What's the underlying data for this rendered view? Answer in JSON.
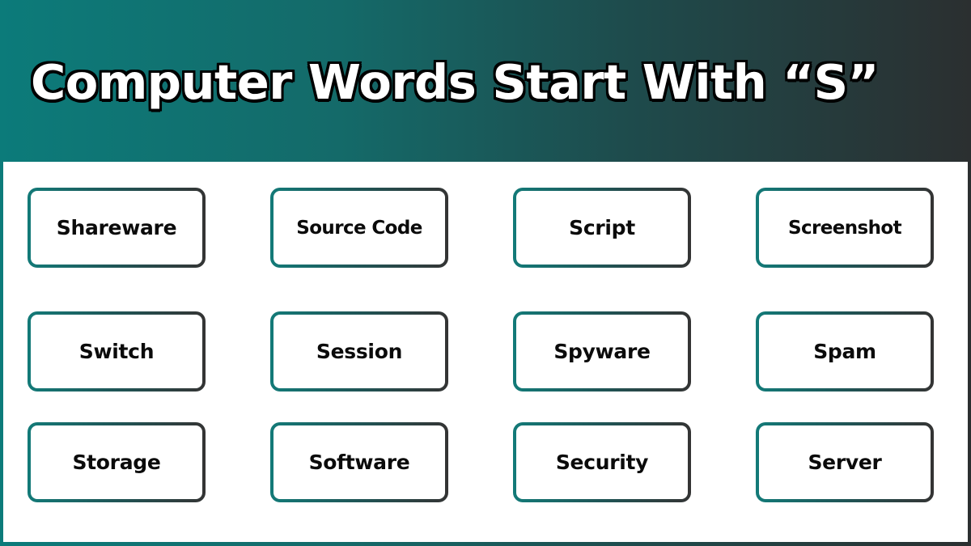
{
  "header": {
    "title": "Computer Words Start With “S”"
  },
  "colors": {
    "gradient_start": "#0c7b7a",
    "gradient_end": "#2b2f30",
    "panel_background": "#ffffff",
    "text": "#0b0b0b"
  },
  "words": [
    [
      "Shareware",
      "Source Code",
      "Script",
      "Screenshot"
    ],
    [
      "Switch",
      "Session",
      "Spyware",
      "Spam"
    ],
    [
      "Storage",
      "Software",
      "Security",
      "Server"
    ]
  ]
}
